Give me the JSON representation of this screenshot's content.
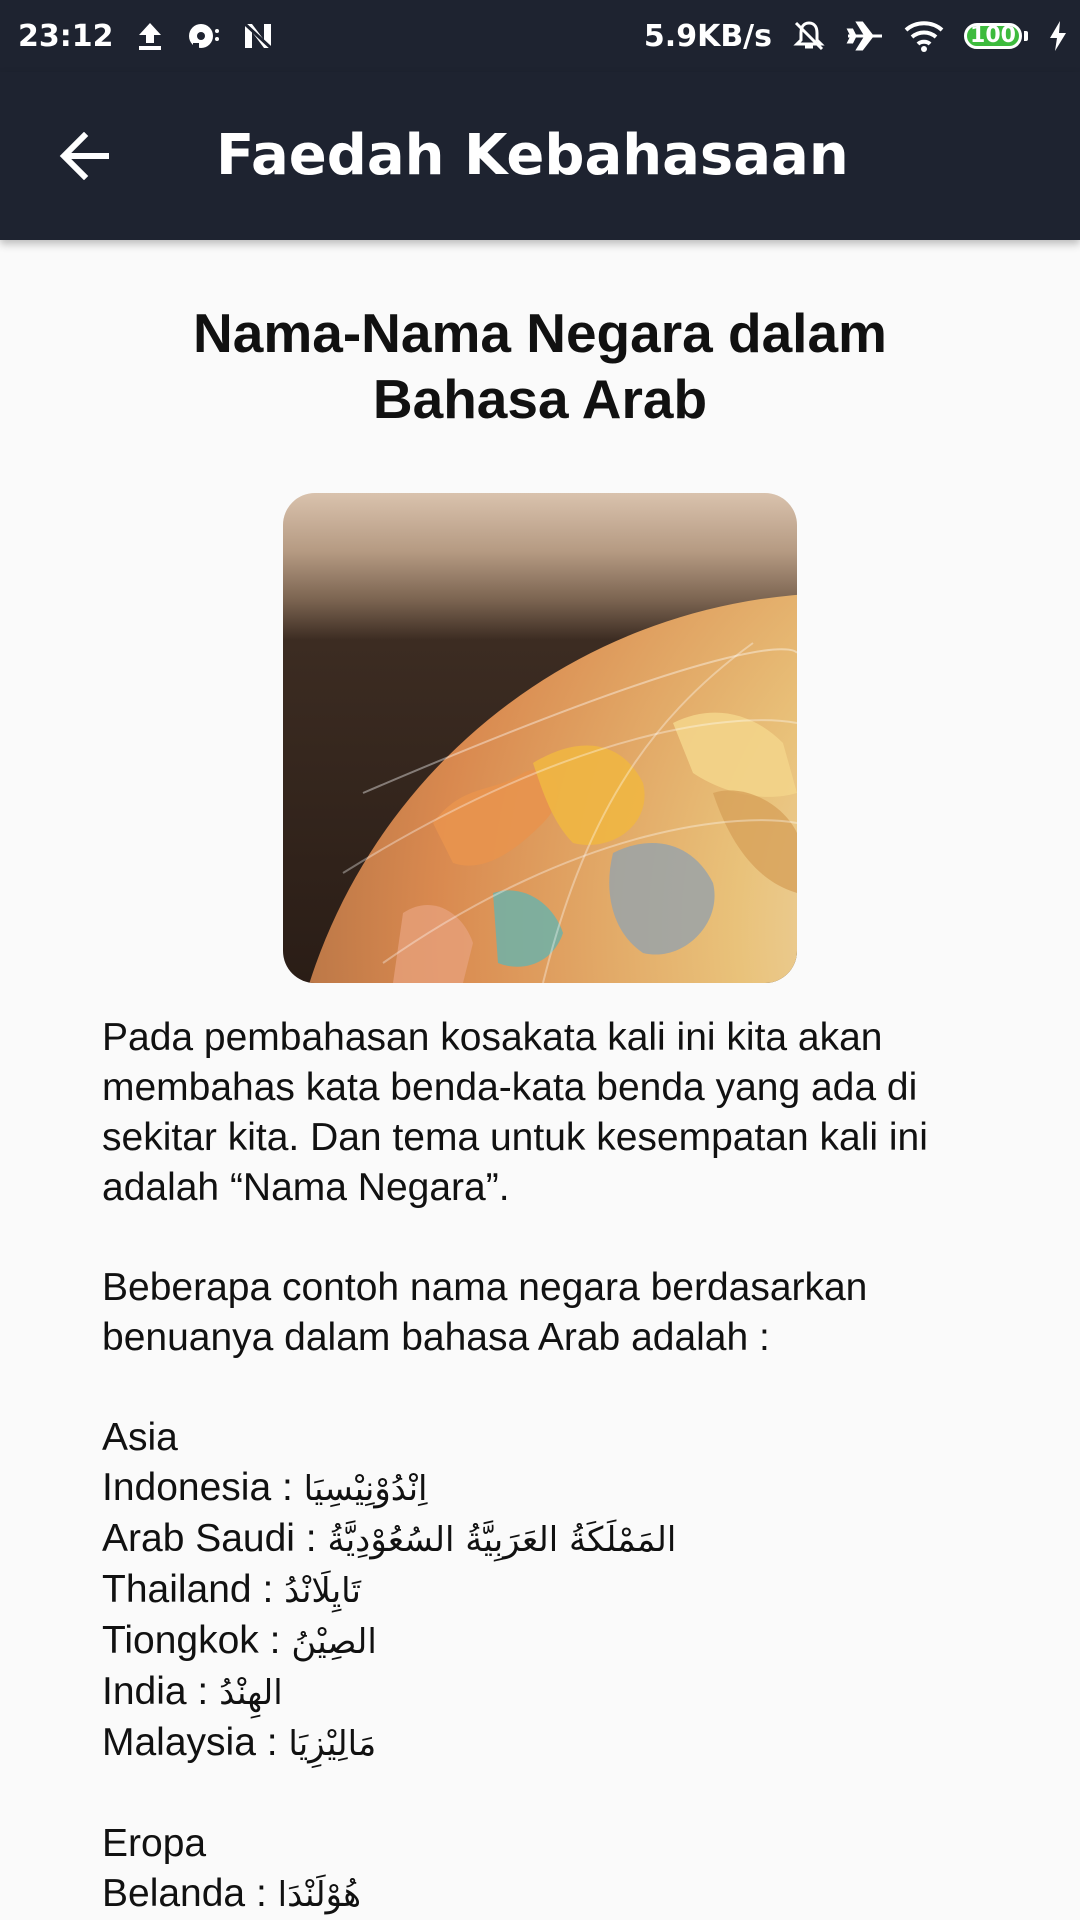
{
  "status_bar": {
    "time": "23:12",
    "network_speed": "5.9KB/s",
    "battery_level": "100",
    "left_icons": [
      "upload-icon",
      "sync-icon",
      "n-logo-icon"
    ],
    "right_icons": [
      "mute-icon",
      "airplane-icon",
      "wifi-icon",
      "battery-icon",
      "charging-icon"
    ]
  },
  "app_bar": {
    "title": "Faedah Kebahasaan",
    "back_icon": "arrow-left-icon"
  },
  "article": {
    "title": "Nama-Nama Negara dalam Bahasa Arab",
    "intro": "Pada pembahasan kosakata kali ini kita akan membahas kata benda-kata benda yang ada di sekitar kita. Dan tema untuk kesempatan kali ini adalah “Nama Negara”.",
    "lead": "Beberapa contoh nama negara berdasarkan benuanya dalam bahasa Arab adalah :",
    "sections": [
      {
        "heading": "Asia",
        "items": [
          {
            "label": "Indonesia",
            "arabic": "اِنْدُوْنِيْسِيَا"
          },
          {
            "label": "Arab Saudi",
            "arabic": "المَمْلَكَةُ العَرَبِيَّةُ السُعُوْدِيَّةُ"
          },
          {
            "label": "Thailand",
            "arabic": "تَايِلَانْدُ"
          },
          {
            "label": "Tiongkok",
            "arabic": "الصِيْنُ"
          },
          {
            "label": "India",
            "arabic": "الهِنْدُ"
          },
          {
            "label": "Malaysia",
            "arabic": "مَالِيْزِيَا"
          }
        ]
      },
      {
        "heading": "Eropa",
        "items": [
          {
            "label": "Belanda",
            "arabic": "هُوْلَنْدَا"
          }
        ]
      }
    ]
  },
  "colors": {
    "app_bar": "#1e2330",
    "background": "#fafafa",
    "text": "#111111",
    "battery_fill": "#3dbb3d"
  }
}
